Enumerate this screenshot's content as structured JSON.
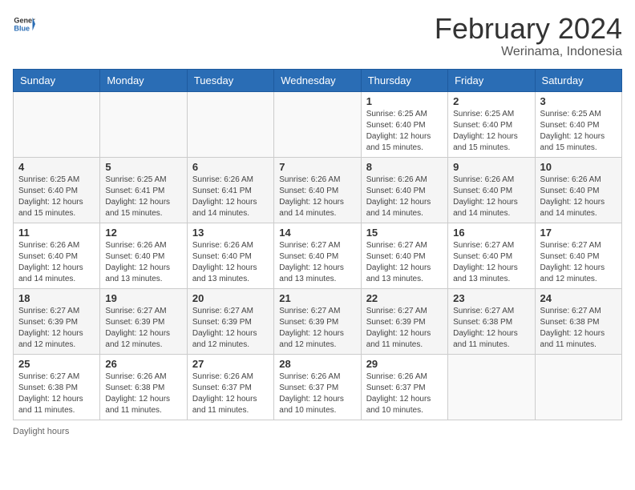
{
  "header": {
    "logo_general": "General",
    "logo_blue": "Blue",
    "title": "February 2024",
    "subtitle": "Werinama, Indonesia"
  },
  "days_of_week": [
    "Sunday",
    "Monday",
    "Tuesday",
    "Wednesday",
    "Thursday",
    "Friday",
    "Saturday"
  ],
  "weeks": [
    [
      {
        "day": "",
        "info": ""
      },
      {
        "day": "",
        "info": ""
      },
      {
        "day": "",
        "info": ""
      },
      {
        "day": "",
        "info": ""
      },
      {
        "day": "1",
        "info": "Sunrise: 6:25 AM\nSunset: 6:40 PM\nDaylight: 12 hours and 15 minutes."
      },
      {
        "day": "2",
        "info": "Sunrise: 6:25 AM\nSunset: 6:40 PM\nDaylight: 12 hours and 15 minutes."
      },
      {
        "day": "3",
        "info": "Sunrise: 6:25 AM\nSunset: 6:40 PM\nDaylight: 12 hours and 15 minutes."
      }
    ],
    [
      {
        "day": "4",
        "info": "Sunrise: 6:25 AM\nSunset: 6:40 PM\nDaylight: 12 hours and 15 minutes."
      },
      {
        "day": "5",
        "info": "Sunrise: 6:25 AM\nSunset: 6:41 PM\nDaylight: 12 hours and 15 minutes."
      },
      {
        "day": "6",
        "info": "Sunrise: 6:26 AM\nSunset: 6:41 PM\nDaylight: 12 hours and 14 minutes."
      },
      {
        "day": "7",
        "info": "Sunrise: 6:26 AM\nSunset: 6:40 PM\nDaylight: 12 hours and 14 minutes."
      },
      {
        "day": "8",
        "info": "Sunrise: 6:26 AM\nSunset: 6:40 PM\nDaylight: 12 hours and 14 minutes."
      },
      {
        "day": "9",
        "info": "Sunrise: 6:26 AM\nSunset: 6:40 PM\nDaylight: 12 hours and 14 minutes."
      },
      {
        "day": "10",
        "info": "Sunrise: 6:26 AM\nSunset: 6:40 PM\nDaylight: 12 hours and 14 minutes."
      }
    ],
    [
      {
        "day": "11",
        "info": "Sunrise: 6:26 AM\nSunset: 6:40 PM\nDaylight: 12 hours and 14 minutes."
      },
      {
        "day": "12",
        "info": "Sunrise: 6:26 AM\nSunset: 6:40 PM\nDaylight: 12 hours and 13 minutes."
      },
      {
        "day": "13",
        "info": "Sunrise: 6:26 AM\nSunset: 6:40 PM\nDaylight: 12 hours and 13 minutes."
      },
      {
        "day": "14",
        "info": "Sunrise: 6:27 AM\nSunset: 6:40 PM\nDaylight: 12 hours and 13 minutes."
      },
      {
        "day": "15",
        "info": "Sunrise: 6:27 AM\nSunset: 6:40 PM\nDaylight: 12 hours and 13 minutes."
      },
      {
        "day": "16",
        "info": "Sunrise: 6:27 AM\nSunset: 6:40 PM\nDaylight: 12 hours and 13 minutes."
      },
      {
        "day": "17",
        "info": "Sunrise: 6:27 AM\nSunset: 6:40 PM\nDaylight: 12 hours and 12 minutes."
      }
    ],
    [
      {
        "day": "18",
        "info": "Sunrise: 6:27 AM\nSunset: 6:39 PM\nDaylight: 12 hours and 12 minutes."
      },
      {
        "day": "19",
        "info": "Sunrise: 6:27 AM\nSunset: 6:39 PM\nDaylight: 12 hours and 12 minutes."
      },
      {
        "day": "20",
        "info": "Sunrise: 6:27 AM\nSunset: 6:39 PM\nDaylight: 12 hours and 12 minutes."
      },
      {
        "day": "21",
        "info": "Sunrise: 6:27 AM\nSunset: 6:39 PM\nDaylight: 12 hours and 12 minutes."
      },
      {
        "day": "22",
        "info": "Sunrise: 6:27 AM\nSunset: 6:39 PM\nDaylight: 12 hours and 11 minutes."
      },
      {
        "day": "23",
        "info": "Sunrise: 6:27 AM\nSunset: 6:38 PM\nDaylight: 12 hours and 11 minutes."
      },
      {
        "day": "24",
        "info": "Sunrise: 6:27 AM\nSunset: 6:38 PM\nDaylight: 12 hours and 11 minutes."
      }
    ],
    [
      {
        "day": "25",
        "info": "Sunrise: 6:27 AM\nSunset: 6:38 PM\nDaylight: 12 hours and 11 minutes."
      },
      {
        "day": "26",
        "info": "Sunrise: 6:26 AM\nSunset: 6:38 PM\nDaylight: 12 hours and 11 minutes."
      },
      {
        "day": "27",
        "info": "Sunrise: 6:26 AM\nSunset: 6:37 PM\nDaylight: 12 hours and 11 minutes."
      },
      {
        "day": "28",
        "info": "Sunrise: 6:26 AM\nSunset: 6:37 PM\nDaylight: 12 hours and 10 minutes."
      },
      {
        "day": "29",
        "info": "Sunrise: 6:26 AM\nSunset: 6:37 PM\nDaylight: 12 hours and 10 minutes."
      },
      {
        "day": "",
        "info": ""
      },
      {
        "day": "",
        "info": ""
      }
    ]
  ],
  "footer": {
    "daylight_label": "Daylight hours"
  }
}
